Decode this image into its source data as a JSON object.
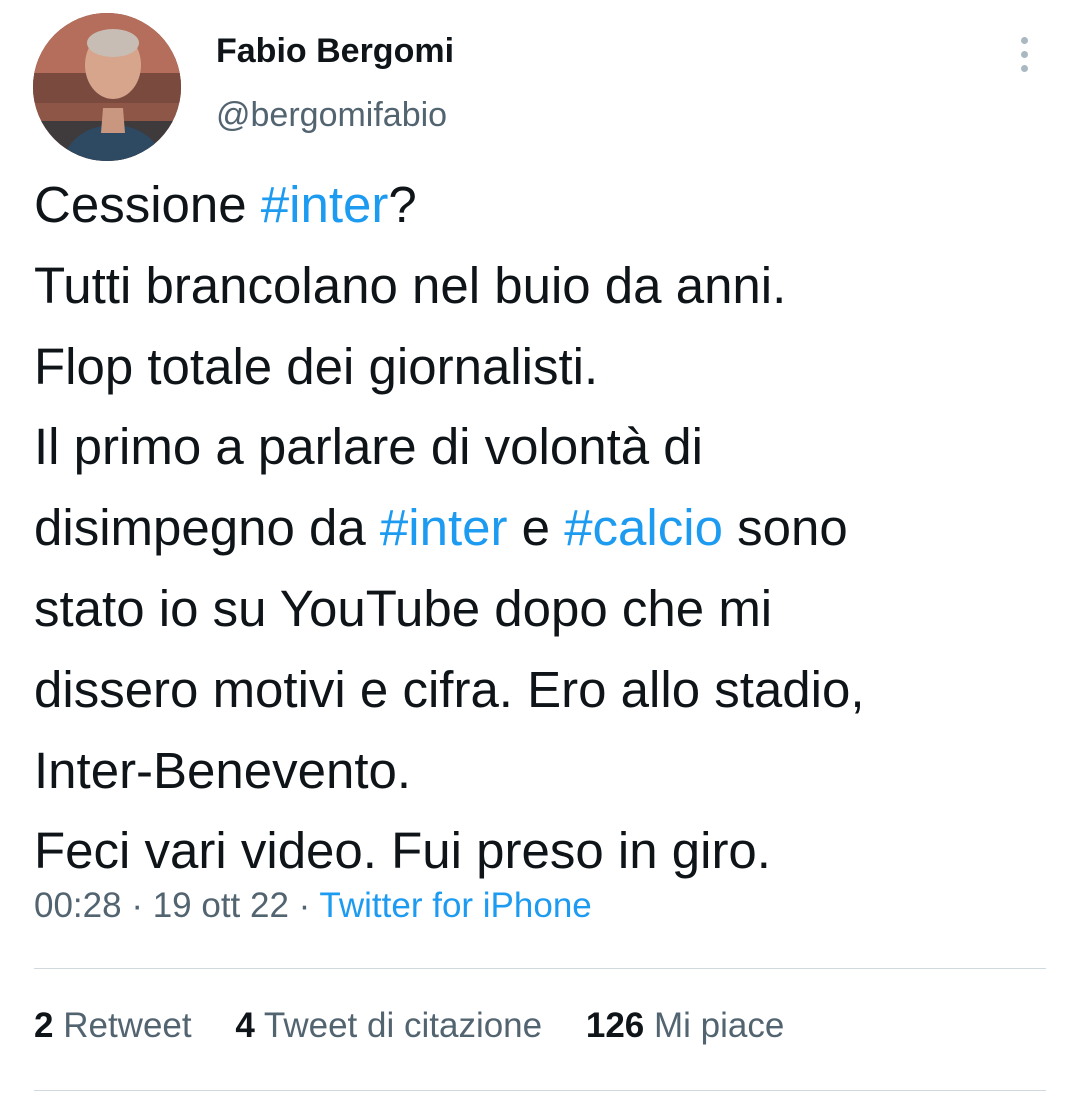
{
  "author": {
    "display_name": "Fabio Bergomi",
    "handle": "@bergomifabio"
  },
  "tweet": {
    "lines": [
      [
        {
          "text": "Cessione "
        },
        {
          "text": "#inter",
          "hashtag": true
        },
        {
          "text": "?"
        }
      ],
      [
        {
          "text": "Tutti brancolano nel buio da anni."
        }
      ],
      [
        {
          "text": "Flop totale dei giornalisti."
        }
      ],
      [
        {
          "text": "Il primo a parlare di volontà di"
        }
      ],
      [
        {
          "text": "disimpegno da "
        },
        {
          "text": "#inter",
          "hashtag": true
        },
        {
          "text": " e "
        },
        {
          "text": "#calcio",
          "hashtag": true
        },
        {
          "text": " sono"
        }
      ],
      [
        {
          "text": "stato io su YouTube dopo che mi"
        }
      ],
      [
        {
          "text": "dissero motivi e cifra. Ero allo stadio,"
        }
      ],
      [
        {
          "text": "Inter-Benevento."
        }
      ],
      [
        {
          "text": "Feci vari video. Fui preso in giro."
        }
      ]
    ]
  },
  "meta": {
    "time": "00:28",
    "separator": " · ",
    "date": "19 ott 22",
    "source": "Twitter for iPhone"
  },
  "stats": {
    "retweets": {
      "count": "2",
      "label": "Retweet"
    },
    "quotes": {
      "count": "4",
      "label": "Tweet di citazione"
    },
    "likes": {
      "count": "126",
      "label": "Mi piace"
    }
  },
  "colors": {
    "text": "#0f1419",
    "secondary": "#536471",
    "link": "#1d9bf0",
    "divider": "#cfd9de"
  },
  "icons": {
    "more": "more-vertical-icon"
  }
}
